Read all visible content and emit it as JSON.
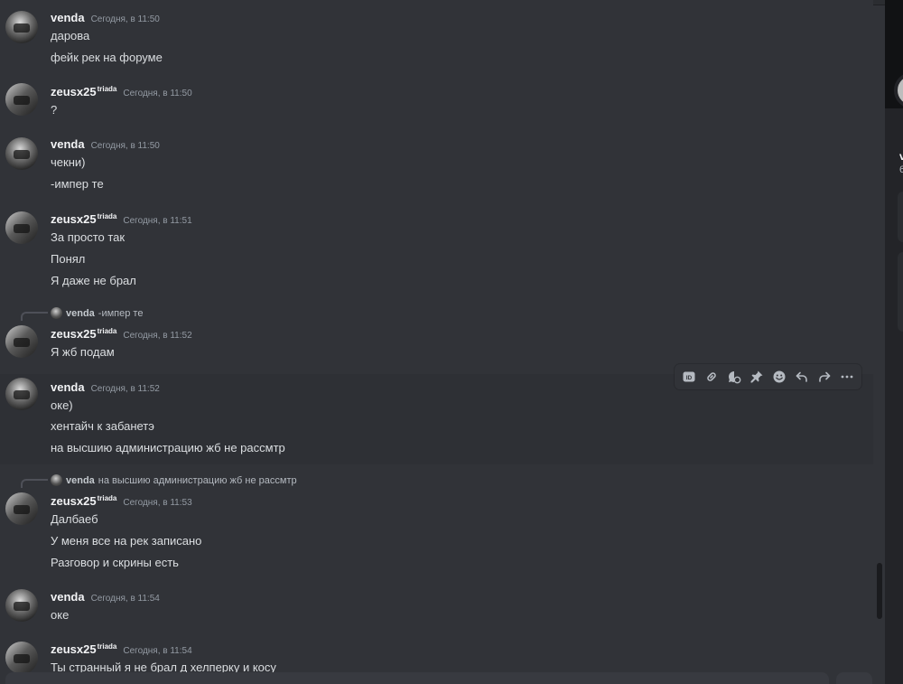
{
  "messages": [
    {
      "user": "venda",
      "time": "Сегодня, в 11:50",
      "lines": [
        "дарова",
        "фейк рек на форуме"
      ]
    },
    {
      "user": "zeusx25",
      "tag": "triada",
      "time": "Сегодня, в 11:50",
      "lines": [
        "?"
      ]
    },
    {
      "user": "venda",
      "time": "Сегодня, в 11:50",
      "lines": [
        "чекни)",
        "-импер те"
      ]
    },
    {
      "user": "zeusx25",
      "tag": "triada",
      "time": "Сегодня, в 11:51",
      "lines": [
        "За просто так",
        "Понял",
        "Я даже не брал"
      ]
    },
    {
      "reply_user": "venda",
      "reply_text": "-импер те",
      "user": "zeusx25",
      "tag": "triada",
      "time": "Сегодня, в 11:52",
      "lines": [
        "Я жб подам"
      ]
    },
    {
      "user": "venda",
      "time": "Сегодня, в 11:52",
      "lines": [
        "оке)",
        "хентайч к забанетэ",
        "на высшию администрацию жб не рассмтр"
      ]
    },
    {
      "reply_user": "venda",
      "reply_text": "на высшию администрацию жб не рассмтр",
      "user": "zeusx25",
      "tag": "triada",
      "time": "Сегодня, в 11:53",
      "lines": [
        "Далбаеб",
        "У меня все на рек записано",
        "Разговор и скрины есть"
      ]
    },
    {
      "user": "venda",
      "time": "Сегодня, в 11:54",
      "lines": [
        "оке"
      ]
    },
    {
      "user": "zeusx25",
      "tag": "triada",
      "time": "Сегодня, в 11:54",
      "lines": [
        "Ты странный я не брал д хелперку и косу"
      ]
    }
  ],
  "toolbar": {
    "icons": [
      "id-icon",
      "link-icon",
      "thread-icon",
      "pin-icon",
      "emoji-icon",
      "reply-icon",
      "forward-icon",
      "more-icon"
    ],
    "more_label": "···"
  },
  "right_panel": {
    "name_initial": "v",
    "sub_initial": "6"
  },
  "colors": {
    "background": "#313338",
    "text": "#dbdee1",
    "muted": "#949ba4",
    "username": "#f2f3f5"
  }
}
